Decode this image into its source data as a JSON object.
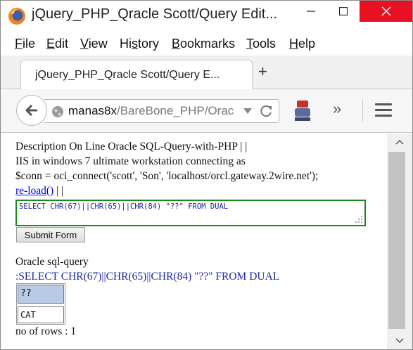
{
  "window": {
    "title": "jQuery_PHP_Qracle Scott/Query Edit..."
  },
  "menu": [
    {
      "pre": "",
      "acc": "F",
      "post": "ile"
    },
    {
      "pre": "",
      "acc": "E",
      "post": "dit"
    },
    {
      "pre": "",
      "acc": "V",
      "post": "iew"
    },
    {
      "pre": "Hi",
      "acc": "s",
      "post": "tory"
    },
    {
      "pre": "",
      "acc": "B",
      "post": "ookmarks"
    },
    {
      "pre": "",
      "acc": "T",
      "post": "ools"
    },
    {
      "pre": "",
      "acc": "H",
      "post": "elp"
    }
  ],
  "tab": {
    "label": "jQuery_PHP_Qracle Scott/Query E...",
    "new_tab": "+"
  },
  "url": {
    "host": "manas8x",
    "path": "/BareBone_PHP/Orac"
  },
  "colors": {
    "close": "#e81123",
    "query_border": "#1a8a1a",
    "query_text": "#1a2aa0",
    "link": "#0000ee",
    "cell_selected": "#b8cbe6"
  },
  "page": {
    "line1": "Description On Line Oracle SQL-Query-with-PHP | |",
    "line2": "IIS in windows 7 ultimate workstation connecting as",
    "line3": "$conn = oci_connect('scott', 'Son', 'localhost/orcl.gateway.2wire.net');",
    "reload_link": "re-load()",
    "reload_suffix": " | |",
    "query_value": "SELECT CHR(67)||CHR(65)||CHR(84) \"??\" FROM DUAL",
    "submit_label": "Submit Form",
    "result_heading": "Oracle sql-query",
    "result_query": ":SELECT CHR(67)||CHR(65)||CHR(84) \"??\" FROM DUAL",
    "table_header": "??",
    "table_value": "CAT",
    "row_count": "no of rows : 1"
  }
}
